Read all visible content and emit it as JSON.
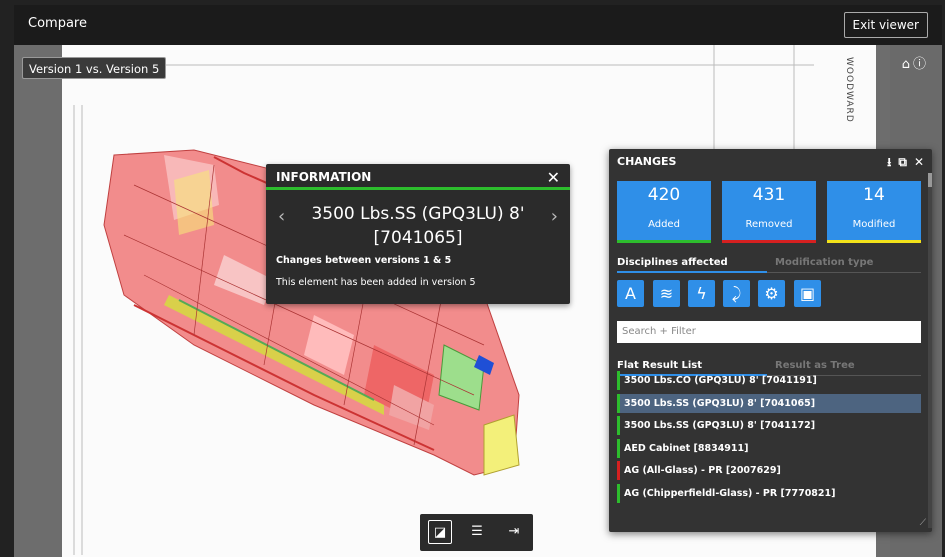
{
  "header": {
    "title": "Compare",
    "exit_label": "Exit viewer"
  },
  "viewer": {
    "version_label": "Version 1 vs. Version 5",
    "icons": [
      "home-icon",
      "info-icon"
    ],
    "logo_text": "WOODWARD"
  },
  "information": {
    "title": "INFORMATION",
    "element_name": "3500 Lbs.SS (GPQ3LU) 8' [7041065]",
    "subtitle": "Changes between versions 1 & 5",
    "message": "This element has been added in version 5",
    "accent": "#2dbd2d"
  },
  "changes": {
    "title": "CHANGES",
    "stats": [
      {
        "value": "420",
        "label": "Added",
        "color": "#2dbd2d"
      },
      {
        "value": "431",
        "label": "Removed",
        "color": "#d62020"
      },
      {
        "value": "14",
        "label": "Modified",
        "color": "#f2e21a"
      }
    ],
    "tabs": {
      "active": "Disciplines affected",
      "inactive": "Modification type"
    },
    "disciplines": [
      "architecture-icon",
      "structural-icon",
      "electrical-icon",
      "plumbing-icon",
      "mechanical-icon",
      "furniture-icon"
    ],
    "search_placeholder": "Search + Filter",
    "list_tabs": {
      "active": "Flat Result List",
      "inactive": "Result as Tree"
    },
    "items": [
      {
        "label": "3500 Lbs.CO (GPQ3LU) 8' [7041191]",
        "color": "#2dbd2d",
        "selected": false
      },
      {
        "label": "3500 Lbs.SS (GPQ3LU) 8' [7041065]",
        "color": "#2dbd2d",
        "selected": true
      },
      {
        "label": "3500 Lbs.SS (GPQ3LU) 8' [7041172]",
        "color": "#2dbd2d",
        "selected": false
      },
      {
        "label": "AED Cabinet [8834911]",
        "color": "#2dbd2d",
        "selected": false
      },
      {
        "label": "AG (All-Glass) - PR [2007629]",
        "color": "#d62020",
        "selected": false
      },
      {
        "label": "AG (Chipperfieldl-Glass) - PR [7770821]",
        "color": "#2dbd2d",
        "selected": false
      }
    ]
  },
  "toolbar": {
    "buttons": [
      "overlay-icon",
      "side-by-side-icon",
      "exit-panel-icon"
    ]
  }
}
